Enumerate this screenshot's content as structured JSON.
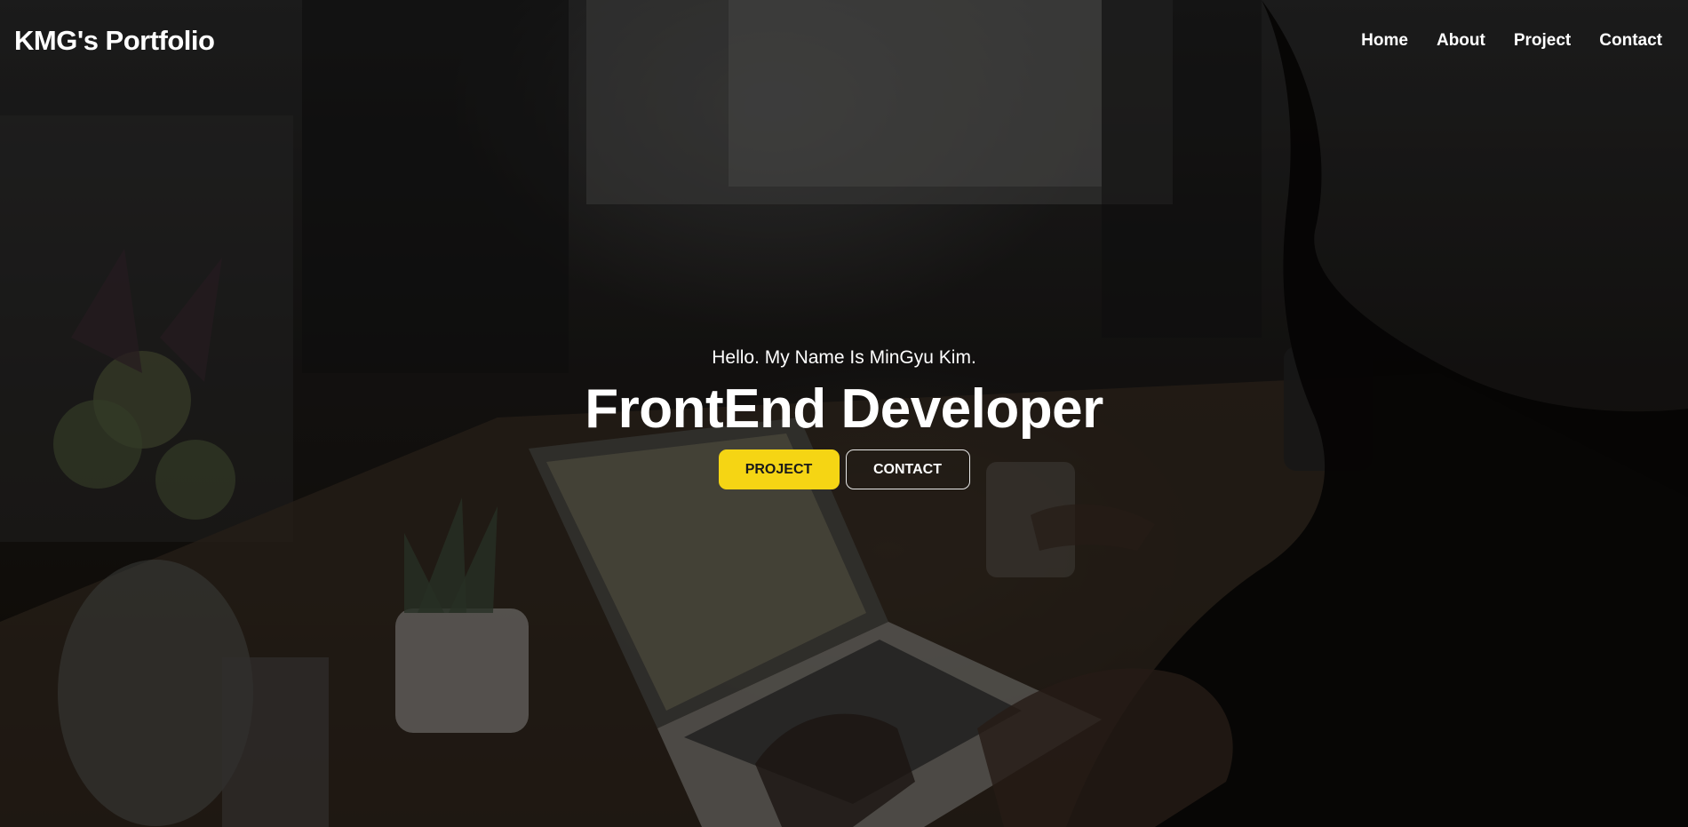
{
  "header": {
    "logo": "KMG's Portfolio",
    "nav": [
      {
        "label": "Home"
      },
      {
        "label": "About"
      },
      {
        "label": "Project"
      },
      {
        "label": "Contact"
      }
    ]
  },
  "hero": {
    "intro": "Hello. My Name Is MinGyu Kim.",
    "title": "FrontEnd Developer",
    "buttons": {
      "project_label": "PROJECT",
      "contact_label": "CONTACT"
    }
  },
  "colors": {
    "accent": "#f5d514",
    "text": "#ffffff",
    "overlay": "#000000"
  }
}
